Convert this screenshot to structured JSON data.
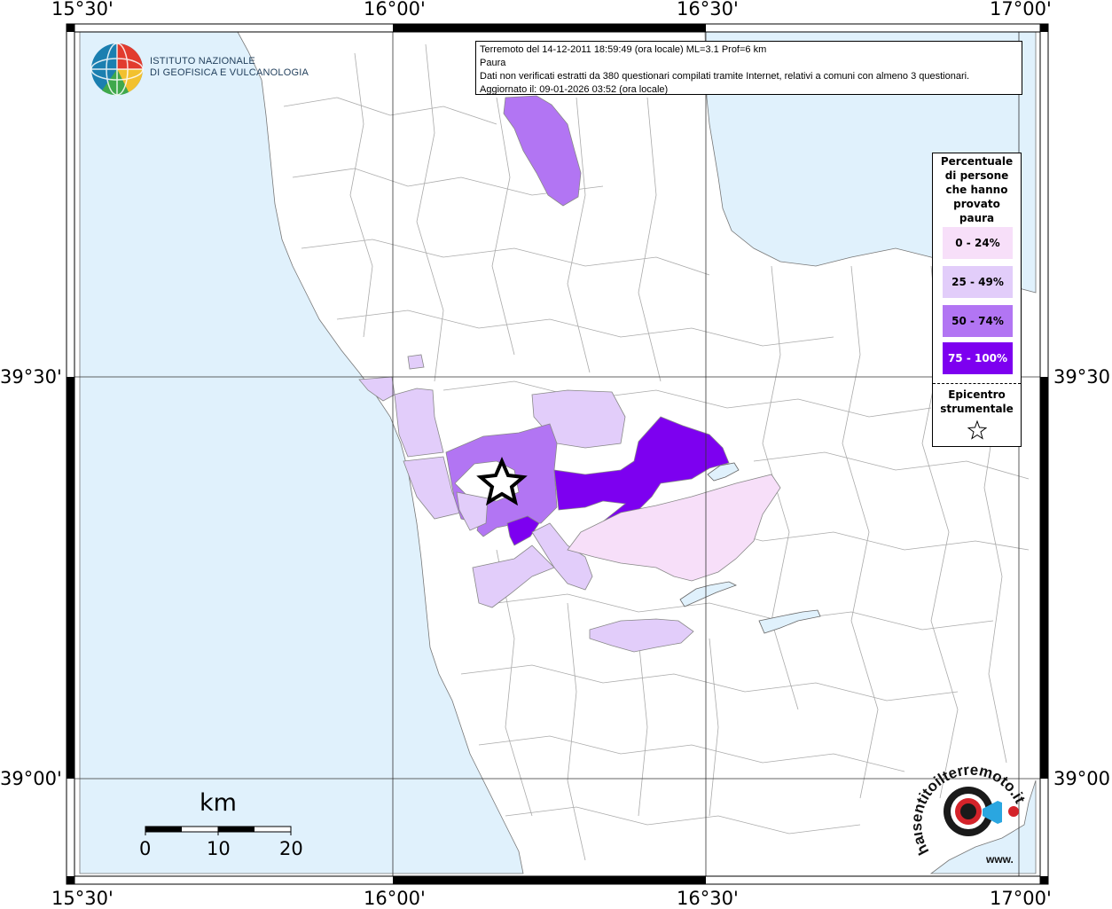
{
  "map": {
    "top_labels": [
      "15°30'",
      "16°00'",
      "16°30'",
      "17°00'"
    ],
    "bottom_labels": [
      "15°30'",
      "16°00'",
      "16°30'",
      "17°00'"
    ],
    "left_labels": [
      "39°30'",
      "39°00'"
    ],
    "right_labels": [
      "39°30'",
      "39°00'"
    ]
  },
  "logo": {
    "line1": "ISTITUTO NAZIONALE",
    "line2": "DI GEOFISICA E VULCANOLOGIA"
  },
  "info": {
    "line1": "Terremoto del 14-12-2011 18:59:49 (ora locale) ML=3.1 Prof=6 km",
    "line2": "Paura",
    "line3": "Dati non verificati estratti da 380 questionari compilati tramite Internet, relativi a comuni con almeno 3 questionari.",
    "line4": "Aggiornato il: 09-01-2026 03:52 (ora locale)"
  },
  "legend": {
    "title_lines": [
      "Percentuale",
      "di persone",
      "che hanno",
      "provato",
      "paura"
    ],
    "items": [
      {
        "label": "0 - 24%",
        "color": "#f7dff9"
      },
      {
        "label": "25 - 49%",
        "color": "#e2cdfa"
      },
      {
        "label": "50 - 74%",
        "color": "#b275f3"
      },
      {
        "label": "75 - 100%",
        "color": "#7d00f0"
      }
    ],
    "epicenter_lines": [
      "Epicentro",
      "strumentale"
    ]
  },
  "scale": {
    "unit": "km",
    "ticks": [
      "0",
      "10",
      "20"
    ]
  },
  "badge": {
    "text_line": "haisentitoilterremoto.it",
    "url_line": "www."
  },
  "colors": {
    "sea": "#e0f1fc",
    "land": "#ffffff",
    "border": "#888888"
  }
}
